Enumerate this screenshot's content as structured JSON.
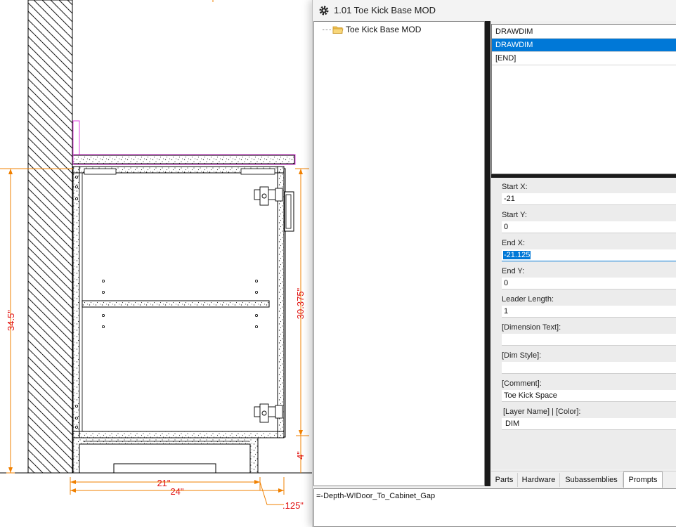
{
  "window": {
    "title": "1.01 Toe Kick Base MOD",
    "icon": "gear-icon"
  },
  "tree": {
    "root_label": "Toe Kick Base MOD",
    "root_icon": "folder-icon"
  },
  "list": {
    "items": [
      "DRAWDIM",
      "DRAWDIM",
      "[END]"
    ],
    "selected_index": 1
  },
  "properties": [
    {
      "label": "Start X:",
      "value": "-21"
    },
    {
      "label": "Start Y:",
      "value": "0"
    },
    {
      "label": "End X:",
      "value": "-21.125",
      "active": true
    },
    {
      "label": "End Y:",
      "value": "0"
    },
    {
      "label": "Leader Length:",
      "value": "1"
    },
    {
      "label": "[Dimension Text]:",
      "value": ""
    },
    {
      "label": "[Dim Style]:",
      "value": ""
    },
    {
      "label": "[Comment]:",
      "value": "Toe Kick Space"
    },
    {
      "label": "[Layer Name] | [Color]:",
      "value": "DIM"
    }
  ],
  "tabs": [
    "Parts",
    "Hardware",
    "Subassemblies",
    "Prompts"
  ],
  "active_tab": "Prompts",
  "formula": "=-Depth-W!Door_To_Cabinet_Gap",
  "drawing": {
    "dimensions": {
      "overall_height": "34.5\"",
      "box_height": "30.375\"",
      "toe_kick_height": "4\"",
      "width_inner": "21\"",
      "width_overall": "24\"",
      "gap": ".125\""
    }
  },
  "colors": {
    "selection": "#0078d7",
    "dimension": "#e01010",
    "extension": "#f08000",
    "countertop_outline": "#e040e0"
  }
}
